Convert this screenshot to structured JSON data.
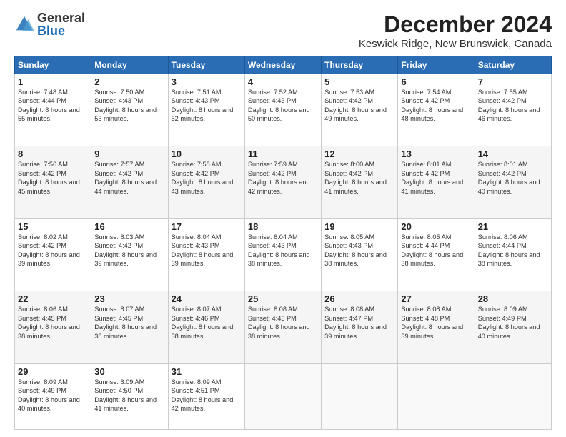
{
  "header": {
    "logo": {
      "general": "General",
      "blue": "Blue"
    },
    "title": "December 2024",
    "subtitle": "Keswick Ridge, New Brunswick, Canada"
  },
  "days_of_week": [
    "Sunday",
    "Monday",
    "Tuesday",
    "Wednesday",
    "Thursday",
    "Friday",
    "Saturday"
  ],
  "weeks": [
    [
      {
        "day": "1",
        "sunrise": "7:48 AM",
        "sunset": "4:44 PM",
        "daylight": "8 hours and 55 minutes."
      },
      {
        "day": "2",
        "sunrise": "7:50 AM",
        "sunset": "4:43 PM",
        "daylight": "8 hours and 53 minutes."
      },
      {
        "day": "3",
        "sunrise": "7:51 AM",
        "sunset": "4:43 PM",
        "daylight": "8 hours and 52 minutes."
      },
      {
        "day": "4",
        "sunrise": "7:52 AM",
        "sunset": "4:43 PM",
        "daylight": "8 hours and 50 minutes."
      },
      {
        "day": "5",
        "sunrise": "7:53 AM",
        "sunset": "4:42 PM",
        "daylight": "8 hours and 49 minutes."
      },
      {
        "day": "6",
        "sunrise": "7:54 AM",
        "sunset": "4:42 PM",
        "daylight": "8 hours and 48 minutes."
      },
      {
        "day": "7",
        "sunrise": "7:55 AM",
        "sunset": "4:42 PM",
        "daylight": "8 hours and 46 minutes."
      }
    ],
    [
      {
        "day": "8",
        "sunrise": "7:56 AM",
        "sunset": "4:42 PM",
        "daylight": "8 hours and 45 minutes."
      },
      {
        "day": "9",
        "sunrise": "7:57 AM",
        "sunset": "4:42 PM",
        "daylight": "8 hours and 44 minutes."
      },
      {
        "day": "10",
        "sunrise": "7:58 AM",
        "sunset": "4:42 PM",
        "daylight": "8 hours and 43 minutes."
      },
      {
        "day": "11",
        "sunrise": "7:59 AM",
        "sunset": "4:42 PM",
        "daylight": "8 hours and 42 minutes."
      },
      {
        "day": "12",
        "sunrise": "8:00 AM",
        "sunset": "4:42 PM",
        "daylight": "8 hours and 41 minutes."
      },
      {
        "day": "13",
        "sunrise": "8:01 AM",
        "sunset": "4:42 PM",
        "daylight": "8 hours and 41 minutes."
      },
      {
        "day": "14",
        "sunrise": "8:01 AM",
        "sunset": "4:42 PM",
        "daylight": "8 hours and 40 minutes."
      }
    ],
    [
      {
        "day": "15",
        "sunrise": "8:02 AM",
        "sunset": "4:42 PM",
        "daylight": "8 hours and 39 minutes."
      },
      {
        "day": "16",
        "sunrise": "8:03 AM",
        "sunset": "4:42 PM",
        "daylight": "8 hours and 39 minutes."
      },
      {
        "day": "17",
        "sunrise": "8:04 AM",
        "sunset": "4:43 PM",
        "daylight": "8 hours and 39 minutes."
      },
      {
        "day": "18",
        "sunrise": "8:04 AM",
        "sunset": "4:43 PM",
        "daylight": "8 hours and 38 minutes."
      },
      {
        "day": "19",
        "sunrise": "8:05 AM",
        "sunset": "4:43 PM",
        "daylight": "8 hours and 38 minutes."
      },
      {
        "day": "20",
        "sunrise": "8:05 AM",
        "sunset": "4:44 PM",
        "daylight": "8 hours and 38 minutes."
      },
      {
        "day": "21",
        "sunrise": "8:06 AM",
        "sunset": "4:44 PM",
        "daylight": "8 hours and 38 minutes."
      }
    ],
    [
      {
        "day": "22",
        "sunrise": "8:06 AM",
        "sunset": "4:45 PM",
        "daylight": "8 hours and 38 minutes."
      },
      {
        "day": "23",
        "sunrise": "8:07 AM",
        "sunset": "4:45 PM",
        "daylight": "8 hours and 38 minutes."
      },
      {
        "day": "24",
        "sunrise": "8:07 AM",
        "sunset": "4:46 PM",
        "daylight": "8 hours and 38 minutes."
      },
      {
        "day": "25",
        "sunrise": "8:08 AM",
        "sunset": "4:46 PM",
        "daylight": "8 hours and 38 minutes."
      },
      {
        "day": "26",
        "sunrise": "8:08 AM",
        "sunset": "4:47 PM",
        "daylight": "8 hours and 39 minutes."
      },
      {
        "day": "27",
        "sunrise": "8:08 AM",
        "sunset": "4:48 PM",
        "daylight": "8 hours and 39 minutes."
      },
      {
        "day": "28",
        "sunrise": "8:09 AM",
        "sunset": "4:49 PM",
        "daylight": "8 hours and 40 minutes."
      }
    ],
    [
      {
        "day": "29",
        "sunrise": "8:09 AM",
        "sunset": "4:49 PM",
        "daylight": "8 hours and 40 minutes."
      },
      {
        "day": "30",
        "sunrise": "8:09 AM",
        "sunset": "4:50 PM",
        "daylight": "8 hours and 41 minutes."
      },
      {
        "day": "31",
        "sunrise": "8:09 AM",
        "sunset": "4:51 PM",
        "daylight": "8 hours and 42 minutes."
      },
      null,
      null,
      null,
      null
    ]
  ]
}
